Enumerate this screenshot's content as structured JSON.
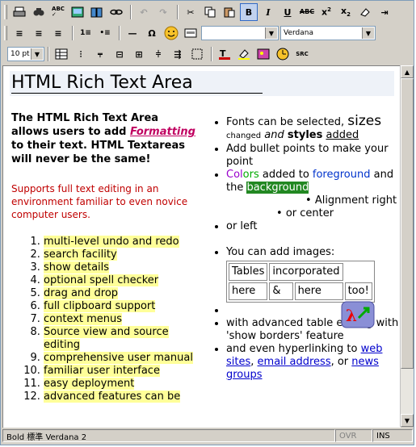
{
  "toolbar2": {
    "font_size_value": "",
    "font_name_value": "Verdana"
  },
  "toolbar3": {
    "size_value": "10 pt",
    "src_label": "SRC"
  },
  "editor": {
    "title": "HTML Rich Text Area",
    "intro": {
      "part1": "The HTML Rich Text Area allows users to add ",
      "formatting": "Formatting",
      "part2": " to their text. HTML Textareas will never be the same!"
    },
    "red_text": "Supports full text editing in an environment familiar to even novice computer users.",
    "list": [
      "multi-level undo and redo",
      "search facility",
      "show details",
      "optional spell checker",
      "drag and drop",
      "full clipboard support",
      "context menus",
      "Source view and source editing",
      "comprehensive user manual",
      "familiar user interface",
      "easy deployment",
      "advanced features can be"
    ],
    "bullets": {
      "fonts": "Fonts can be selected,",
      "sizes": "sizes",
      "changed": "changed",
      "and": "and",
      "styles": "styles",
      "added": "added",
      "bullet_points": "Add bullet points to make your point",
      "colors_c": "Col",
      "colors_o": "ors",
      "added_to": " added to ",
      "foreground": "foreground",
      "and_the": " and the ",
      "background": "background",
      "align_right": "Alignment right",
      "center": "or center",
      "left": "or left",
      "images": "You can add images:",
      "table_editing": "with advanced table editing with 'show borders' feature",
      "hyperlinking": "and even hyperlinking to ",
      "web_sites": "web sites",
      "comma": ", ",
      "email": "email address",
      "or": ", or ",
      "news": "news groups"
    },
    "table": [
      [
        "Tables",
        "incorporated",
        ""
      ],
      [
        "here",
        "&",
        "here",
        "too!"
      ]
    ]
  },
  "status": {
    "format": "Bold 標準 Verdana 2",
    "ovr": "OVR",
    "ins": "INS"
  },
  "colors": {
    "accent": "#316ac5",
    "highlight": "#ffff99",
    "red": "#c00000"
  }
}
